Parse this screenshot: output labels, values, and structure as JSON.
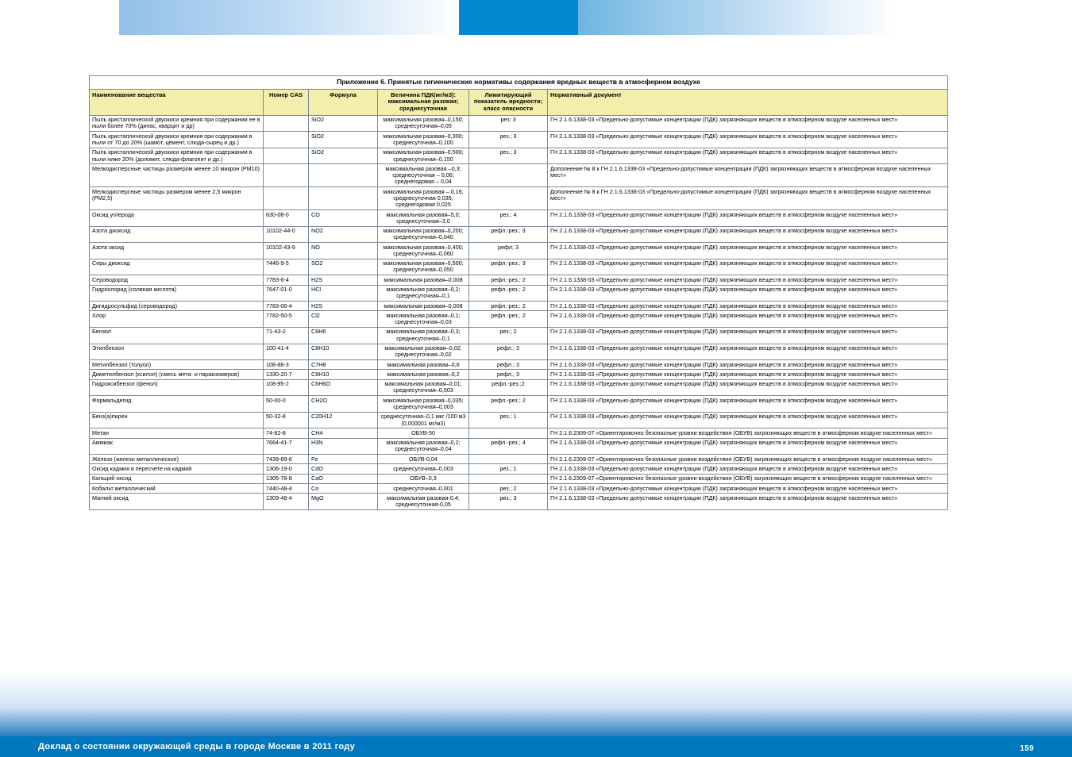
{
  "title": "Приложение 6. Принятые гигиенические нормативы содержания вредных веществ в атмосферном воздухе",
  "headers": [
    "Наименование вещества",
    "Номер CAS",
    "Формула",
    "Величина ПДК(мг/м3): максимальная разовая; среднесуточная",
    "Лимитирующий показатель вредности; класс опасности",
    "Нормативный документ"
  ],
  "rows": [
    [
      "Пыль кристаллической двуокиси кремния при содержании ее в пыли более 70% (динас, кварцит и др)",
      "",
      "SiO2",
      "максимальная разовая–0,150; среднесуточная–0,05",
      "рез; 3",
      "ГН 2.1.6.1338-03 «Предельно-допустимые концентрации (ПДК) загрязняющих веществ в атмосферном воздухе населенных мест»"
    ],
    [
      "Пыль кристаллической двуокиси кремния при содержании в пыли от 70 до 20% (шамот, цемент, слюда-сырец и др.)",
      "",
      "SiO2",
      "максимальная разовая–0,300; среднесуточная–0,100",
      "рез.; 3",
      "ГН 2.1.6.1338-03 «Предельно-допустимые концентрации (ПДК) загрязняющих веществ в атмосферном воздухе населенных мест»"
    ],
    [
      "Пыль кристаллической двуокиси кремния при содержании в пыли ниже 20% (доломит, слюда-флагопит и др.)",
      "",
      "SiO2",
      "максимальная разовая–0,500; среднесуточная–0,150",
      "рез.; 3",
      "ГН 2.1.6.1338-03 «Предельно-допустимые концентрации (ПДК) загрязняющих веществ в атмосферном воздухе населенных мест»"
    ],
    [
      "Мелкодисперсные частицы размером менее 10 микрон (PM10)",
      "",
      "",
      "максимальная разовая –0,3; среднесуточная – 0,06; среднегодовая – 0,04",
      "",
      "Дополнение № 8 к ГН 2.1.6.1338-03 «Предельно-допустимые концентрации (ПДК) загрязняющих веществ в атмосферном воздухе населенных мест»"
    ],
    [
      "Мелкодисперсные частицы размером менее 2,5 микрон (PM2,5)",
      "",
      "",
      "максимальная разовая – 0,16; среднесуточная 0,035; среднегодовая 0,025",
      "",
      "Дополнение № 8 к ГН 2.1.6.1338-03 «Предельно-допустимые концентрации (ПДК) загрязняющих веществ в атмосферном воздухе населенных мест»"
    ],
    [
      "Оксид углерода",
      "630-08-0",
      "CO",
      "максимальная разовая–5,0; среднесуточная–3,0",
      "рез.; 4",
      "ГН 2.1.6.1338-03 «Предельно-допустимые концентрации (ПДК) загрязняющих веществ в атмосферном воздухе населенных мест»"
    ],
    [
      "Азота диоксид",
      "10102-44-0",
      "NO2",
      "максимальная разовая–0,200; среднесуточная–0,040",
      "рефл.-рез.; 3",
      "ГН 2.1.6.1338-03 «Предельно-допустимые концентрации (ПДК) загрязняющих веществ в атмосферном воздухе населенных мест»"
    ],
    [
      "Азота оксид",
      "10102-43-9",
      "NO",
      "максимальная разовая–0,400; среднесуточная–0,060",
      "рефл; 3",
      "ГН 2.1.6.1338-03 «Предельно-допустимые концентрации (ПДК) загрязняющих веществ в атмосферном воздухе населенных мест»"
    ],
    [
      "Серы диоксид",
      "7446-9-5",
      "SO2",
      "максимальная разовая–0,500; среднесуточная–0,050",
      "рефл.-рез.; 3",
      "ГН 2.1.6.1338-03 «Предельно-допустимые концентрации (ПДК) загрязняющих веществ в атмосферном воздухе населенных мест»"
    ],
    [
      "Сероводород",
      "7783-6-4",
      "H2S",
      "максимальная разовая–0,008",
      "рефл.-рез.; 2",
      "ГН 2.1.6.1338-03 «Предельно-допустимые концентрации (ПДК) загрязняющих веществ в атмосферном воздухе населенных мест»"
    ],
    [
      "Гидрохлорид (соляная кислота)",
      "7647-01-0",
      "HCl",
      "максимальная разовая–0,2; среднесуточная–0,1",
      "рефл.-рез.; 2",
      "ГН 2.1.6.1338-03 «Предельно-допустимые концентрации (ПДК) загрязняющих веществ в атмосферном воздухе населенных мест»"
    ],
    [
      "Дигидросульфид (сероводород)",
      "7783-06-4",
      "H2S",
      "максимальная разовая–0,008",
      "рефл.-рез.; 2",
      "ГН 2.1.6.1338-03 «Предельно-допустимые концентрации (ПДК) загрязняющих веществ в атмосферном воздухе населенных мест»"
    ],
    [
      "Хлор",
      "7782-50-5",
      "Cl2",
      "максимальная разовая–0,1; среднесуточная–0,03",
      "рефл.-рез.; 2",
      "ГН 2.1.6.1338-03 «Предельно-допустимые концентрации (ПДК) загрязняющих веществ в атмосферном воздухе населенных мест»"
    ],
    [
      "Бензол",
      "71-43-2",
      "C6H6",
      "максимальная разовая–0,3; среднесуточная–0,1",
      "рез.; 2",
      "ГН 2.1.6.1338-03 «Предельно-допустимые концентрации (ПДК) загрязняющих веществ в атмосферном воздухе населенных мест»"
    ],
    [
      "Этилбензол",
      "100-41-4",
      "C8H10",
      "максимальная разовая–0,02; среднесуточная–0,02",
      "рефл.; 3",
      "ГН 2.1.6.1338-03 «Предельно-допустимые концентрации (ПДК) загрязняющих веществ в атмосферном воздухе населенных мест»"
    ],
    [
      "Метилбензол (толуол)",
      "108-88-3",
      "C7H8",
      "максимальная разовая–0,6",
      "рефл.; 3",
      "ГН 2.1.6.1338-03 «Предельно-допустимые концентрации (ПДК) загрязняющих веществ в атмосферном воздухе населенных мест»"
    ],
    [
      "Диметилбензол (ксилол) (смесь мета- и параизомеров)",
      "1330-20-7",
      "C8H10",
      "максимальная разовая–0,2",
      "рефл.; 3",
      "ГН 2.1.6.1338-03 «Предельно-допустимые концентрации (ПДК) загрязняющих веществ в атмосферном воздухе населенных мест»"
    ],
    [
      "Гидроксибензол (фенол)",
      "108-95-2",
      "C6H6O",
      "максимальная разовая–0,01; среднесуточная–0,003",
      "рефл.-рез.;2",
      "ГН 2.1.6.1338-03 «Предельно-допустимые концентрации (ПДК) загрязняющих веществ в атмосферном воздухе населенных мест»"
    ],
    [
      "Формальдегид",
      "50-00-0",
      "CH2O",
      "максимальная разовая–0,035; среднесуточная–0,003",
      "рефл.-рез.; 2",
      "ГН 2.1.6.1338-03 «Предельно-допустимые концентрации (ПДК) загрязняющих веществ в атмосферном воздухе населенных мест»"
    ],
    [
      "Бенз(а)пирен",
      "50-32-8",
      "C20H12",
      "среднесуточная–0,1 мкг /100 м3 (0,000001 мг/м3)",
      "рез.; 1",
      "ГН 2.1.6.1338-03 «Предельно-допустимые концентрации (ПДК) загрязняющих веществ в атмосферном воздухе населенных мест»"
    ],
    [
      "Метан",
      "74-82-8",
      "CH4",
      "ОБУВ-50",
      "",
      "ГН 2.1.6.2309-07 «Ориентировочно безопасные уровни воздействия (ОБУВ) загрязняющих веществ в атмосферном воздухе населенных мест»"
    ],
    [
      "Аммиак",
      "7664-41-7",
      "H3N",
      "максимальная разовая–0,2; среднесуточная–0,04",
      "рефл.-рез.; 4",
      "ГН 2.1.6.1338-03 «Предельно-допустимые концентрации (ПДК) загрязняющих веществ в атмосферном воздухе населенных мест»"
    ],
    [
      "Железо (железо металлическое)",
      "7439-89-6",
      "Fe",
      "ОБУВ-0,04",
      "",
      "ГН 2.1.6.2309-07 «Ориентировочно безопасные уровни воздействия (ОБУВ) загрязняющих веществ в атмосферном воздухе населенных мест»"
    ],
    [
      "Оксид кадмия в пересчете на кадмий",
      "1306-19-0",
      "CdO",
      "среднесуточная–0,003",
      "рез.; 1",
      "ГН 2.1.6.1338-03 «Предельно-допустимые концентрации (ПДК) загрязняющих веществ в атмосферном воздухе населенных мест»"
    ],
    [
      "Кальций оксид",
      "1305-78-8",
      "CaO",
      "ОБУВ–0,3",
      "",
      "ГН 2.1.6.2309-07 «Ориентировочно безопасные уровни воздействия (ОБУВ) загрязняющих веществ в атмосферном воздухе населенных мест»"
    ],
    [
      "Кобальт металлический",
      "7440-48-4",
      "Co",
      "среднесуточная–0,001",
      "рез.; 2",
      "ГН 2.1.6.1338-03 «Предельно-допустимые концентрации (ПДК) загрязняющих веществ в атмосферном воздухе населенных мест»"
    ],
    [
      "Магний оксид",
      "1309-48-4",
      "MgO",
      "максимальная разовая-0,4; среднесуточная-0,05",
      "рез.; 3",
      "ГН 2.1.6.1338-03 «Предельно-допустимые концентрации (ПДК) загрязняющих веществ в атмосферном воздухе населенных мест»"
    ]
  ],
  "footer": "Доклад о состоянии окружающей среды в городе Москве в 2011 году",
  "page": "159"
}
